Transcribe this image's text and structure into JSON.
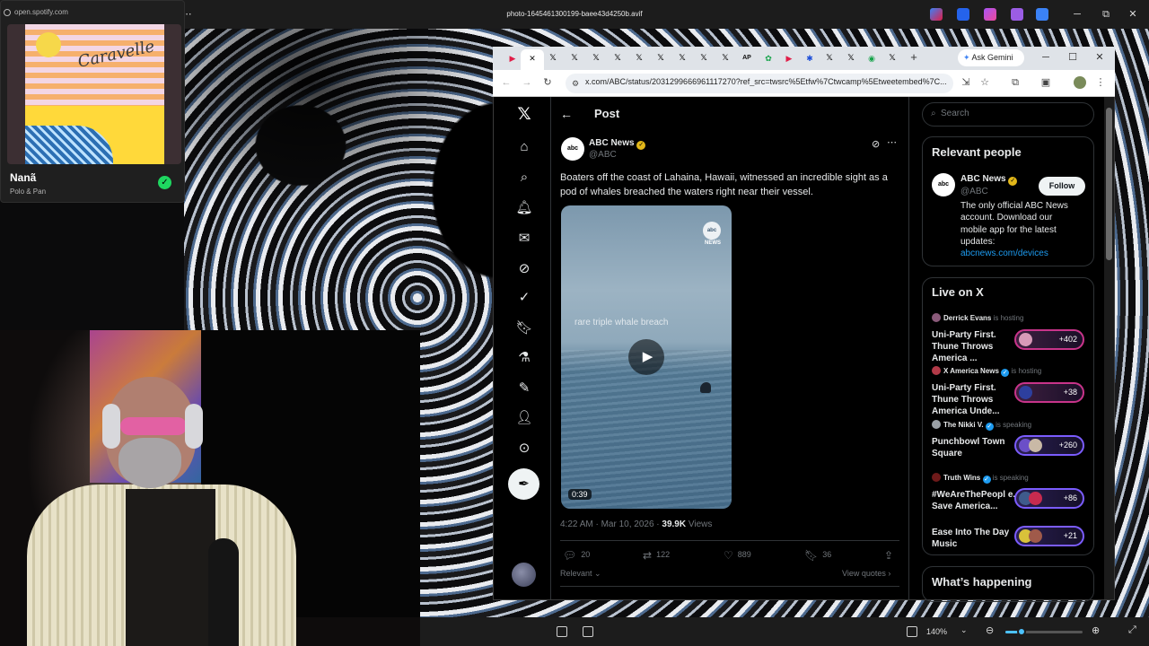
{
  "viewer": {
    "title": "photo-1645461300199-baee43d4250b.avif",
    "zoom": "140%"
  },
  "spotify": {
    "url": "open.spotify.com",
    "track_title": "Nanã",
    "artist": "Polo & Pan",
    "album_script_text": "Caravelle",
    "saved_icon": "check-icon"
  },
  "browser": {
    "url": "x.com/ABC/status/2031299666961117270?ref_src=twsrc%5Etfw%7Ctwcamp%5Etweetembed%7C...",
    "ask_gemini": "Ask Gemini",
    "new_tab": "+"
  },
  "x": {
    "page_title": "Post",
    "post": {
      "author_name": "ABC News",
      "author_handle": "@ABC",
      "avatar_text": "abc NEWS",
      "text": "Boaters off the coast of Lahaina, Hawaii, witnessed an incredible sight as a pod of whales breached the waters right near their vessel.",
      "video_caption": "rare triple whale breach",
      "video_logo": "abc",
      "video_logo_sub": "NEWS",
      "video_duration": "0:39",
      "time": "4:22 AM · Mar 10, 2026 · ",
      "views_count": "39.9K",
      "views_label": " Views",
      "replies": "20",
      "reposts": "122",
      "likes": "889",
      "bookmarks": "36",
      "sort_label": "Relevant",
      "view_quotes": "View quotes"
    },
    "sidebar": {
      "search_placeholder": "Search",
      "relevant_people_title": "Relevant people",
      "person": {
        "name": "ABC News",
        "handle": "@ABC",
        "follow_label": "Follow",
        "bio": "The only official ABC News account. Download our mobile app for the latest updates:",
        "link": "abcnews.com/devices"
      },
      "live_title": "Live on X",
      "live": [
        {
          "host": "Derrick Evans",
          "role": "is hosting",
          "title": "Uni-Party First. Thune Throws America ...",
          "count": "+402"
        },
        {
          "host": "X America News",
          "role": "is hosting",
          "title": "Uni-Party First. Thune Throws America Unde...",
          "count": "+38"
        },
        {
          "host": "The Nikki V.",
          "role": "is speaking",
          "title": "Punchbowl Town Square",
          "count": "+260"
        },
        {
          "host": "Truth Wins",
          "role": "is speaking",
          "title": "#WeAreThePeopl e. Save America...",
          "count": "+86"
        },
        {
          "host": "",
          "role": "",
          "title": "Ease Into The Day Music",
          "count": "+21"
        }
      ],
      "happening_title": "What’s happening"
    }
  },
  "colors": {
    "accent_blue": "#1d9bf0",
    "verified_gold": "#e2b719",
    "spotify_green": "#1ed760"
  }
}
